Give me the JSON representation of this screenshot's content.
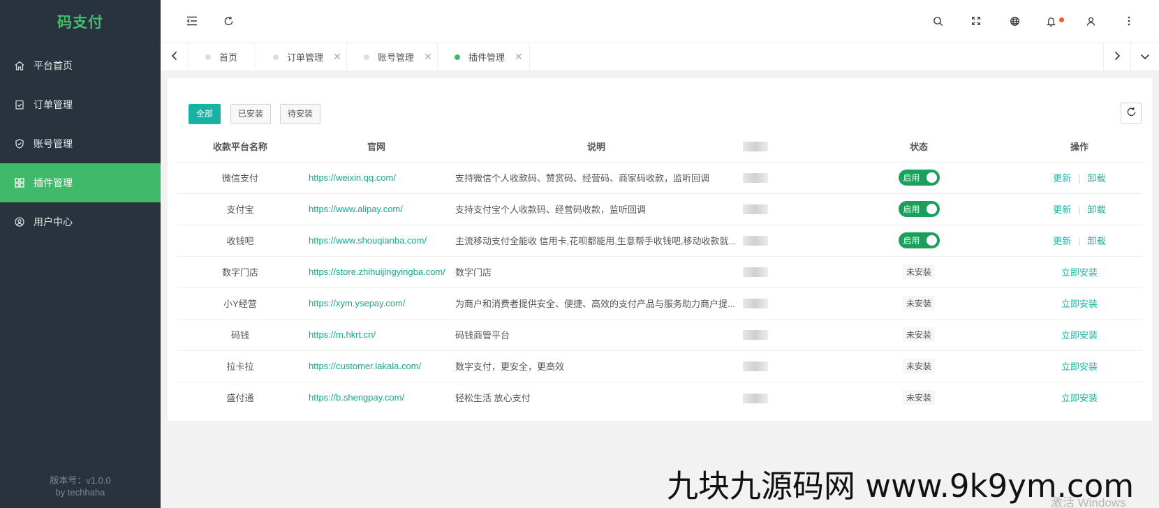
{
  "app": {
    "title": "码支付",
    "version_label": "版本号：v1.0.0",
    "author": "by techhaha"
  },
  "sidebar": {
    "items": [
      {
        "label": "平台首页",
        "icon": "home-icon"
      },
      {
        "label": "订单管理",
        "icon": "clipboard-icon"
      },
      {
        "label": "账号管理",
        "icon": "shield-icon"
      },
      {
        "label": "插件管理",
        "icon": "grid-icon",
        "active": true
      },
      {
        "label": "用户中心",
        "icon": "user-circle-icon"
      }
    ]
  },
  "header": {
    "icons": [
      "menu-fold-icon",
      "refresh-icon",
      "search-icon",
      "fullscreen-icon",
      "globe-icon",
      "bell-icon",
      "user-icon",
      "more-icon"
    ]
  },
  "tabs": [
    {
      "label": "首页"
    },
    {
      "label": "订单管理"
    },
    {
      "label": "账号管理"
    },
    {
      "label": "插件管理",
      "active": true
    }
  ],
  "filters": {
    "all": "全部",
    "installed": "已安装",
    "pending": "待安装"
  },
  "table": {
    "headers": {
      "name": "收款平台名称",
      "site": "官网",
      "desc": "说明",
      "status": "状态",
      "ops": "操作"
    },
    "rows": [
      {
        "name": "微信支付",
        "site": "https://weixin.qq.com/",
        "desc": "支持微信个人收款码、赞赏码、经营码、商家码收款，监听回调",
        "status": "启用"
      },
      {
        "name": "支付宝",
        "site": "https://www.alipay.com/",
        "desc": "支持支付宝个人收款码、经营码收款，监听回调",
        "status": "启用"
      },
      {
        "name": "收钱吧",
        "site": "https://www.shouqianba.com/",
        "desc": "主流移动支付全能收 信用卡,花呗都能用,生意帮手收钱吧,移动收款就...",
        "status": "启用"
      },
      {
        "name": "数字门店",
        "site": "https://store.zhihuijingyingba.com/",
        "desc": "数字门店",
        "status": "未安装"
      },
      {
        "name": "小Y经营",
        "site": "https://xym.ysepay.com/",
        "desc": "为商户和消费者提供安全、便捷、高效的支付产品与服务助力商户提...",
        "status": "未安装"
      },
      {
        "name": "码钱",
        "site": "https://m.hkrt.cn/",
        "desc": "码钱商管平台",
        "status": "未安装"
      },
      {
        "name": "拉卡拉",
        "site": "https://customer.lakala.com/",
        "desc": "数字支付，更安全，更高效",
        "status": "未安装"
      },
      {
        "name": "盛付通",
        "site": "https://b.shengpay.com/",
        "desc": "轻松生活 放心支付",
        "status": "未安装"
      }
    ],
    "ops": {
      "update": "更新",
      "uninstall": "卸载",
      "install": "立即安装"
    }
  },
  "overlay": {
    "watermark": "九块九源码网 www.9k9ym.com",
    "activate": "激活 Windows"
  },
  "colors": {
    "sidebar_bg": "#28333e",
    "accent_green": "#3fb96a",
    "teal": "#16b3a5",
    "switch_on": "#1d9e5a"
  }
}
